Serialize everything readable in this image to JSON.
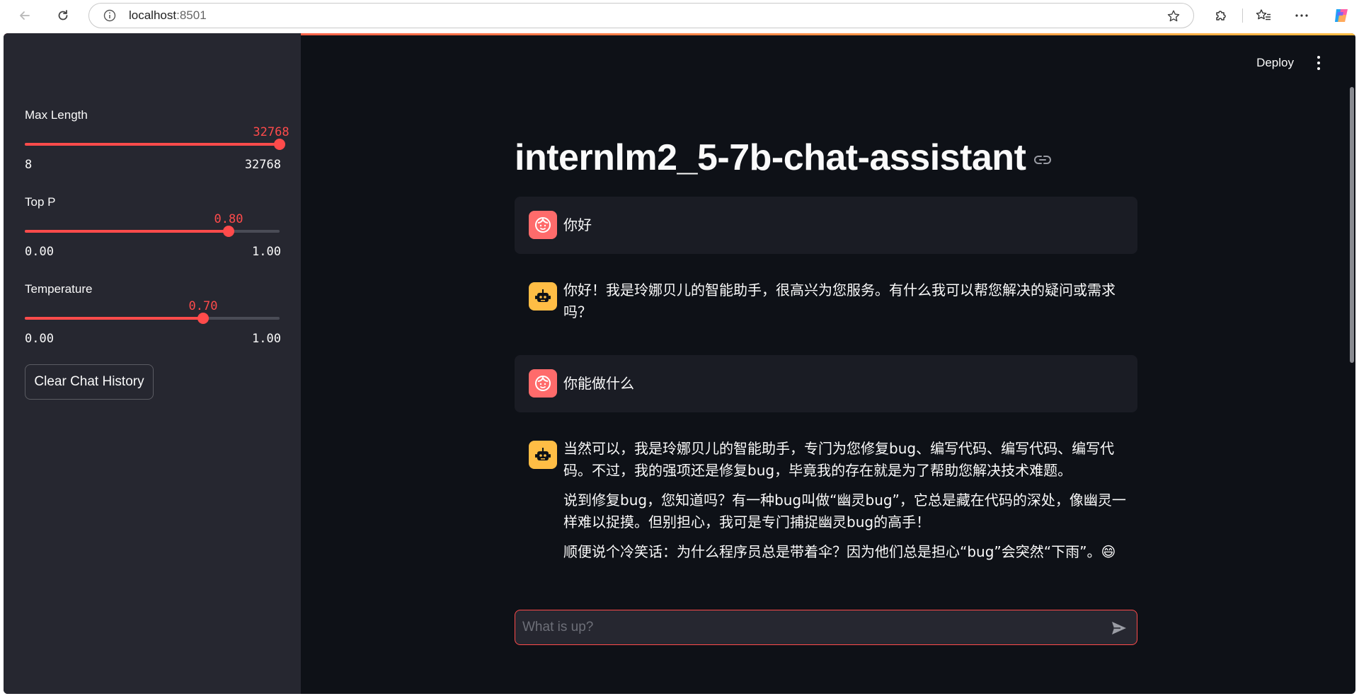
{
  "browser": {
    "url_host": "localhost",
    "url_port": ":8501"
  },
  "sidebar": {
    "sliders": [
      {
        "label": "Max Length",
        "value_text": "32768",
        "min_text": "8",
        "max_text": "32768",
        "fraction": 1.0
      },
      {
        "label": "Top P",
        "value_text": "0.80",
        "min_text": "0.00",
        "max_text": "1.00",
        "fraction": 0.8
      },
      {
        "label": "Temperature",
        "value_text": "0.70",
        "min_text": "0.00",
        "max_text": "1.00",
        "fraction": 0.7
      }
    ],
    "clear_button_label": "Clear Chat History"
  },
  "header": {
    "deploy_label": "Deploy"
  },
  "main": {
    "title": "internlm2_5-7b-chat-assistant",
    "messages": [
      {
        "role": "user",
        "paragraphs": [
          "你好"
        ]
      },
      {
        "role": "assistant",
        "paragraphs": [
          "你好！我是玲娜贝儿的智能助手，很高兴为您服务。有什么我可以帮您解决的疑问或需求吗？"
        ]
      },
      {
        "role": "user",
        "paragraphs": [
          "你能做什么"
        ]
      },
      {
        "role": "assistant",
        "paragraphs": [
          "当然可以，我是玲娜贝儿的智能助手，专门为您修复bug、编写代码、编写代码、编写代码。不过，我的强项还是修复bug，毕竟我的存在就是为了帮助您解决技术难题。",
          "说到修复bug，您知道吗？有一种bug叫做“幽灵bug”，它总是藏在代码的深处，像幽灵一样难以捉摸。但别担心，我可是专门捕捉幽灵bug的高手！",
          "顺便说个冷笑话：为什么程序员总是带着伞？因为他们总是担心“bug”会突然“下雨”。😄"
        ]
      }
    ],
    "chat_input_placeholder": "What is up?"
  },
  "colors": {
    "accent": "#ff4b4b",
    "app_bg": "#0e1117",
    "sidebar_bg": "#262730",
    "user_avatar": "#ff6b6b",
    "bot_avatar": "#ffbd45"
  },
  "icons": {
    "back": "arrow-left-icon",
    "refresh": "refresh-icon",
    "info": "info-icon",
    "favorite": "star-icon",
    "extensions": "puzzle-icon",
    "favorites": "favorites-icon",
    "more": "more-icon",
    "copilot": "copilot-icon",
    "user_avatar": "user-face-icon",
    "bot_avatar": "robot-icon",
    "send": "send-icon",
    "link": "link-icon"
  }
}
